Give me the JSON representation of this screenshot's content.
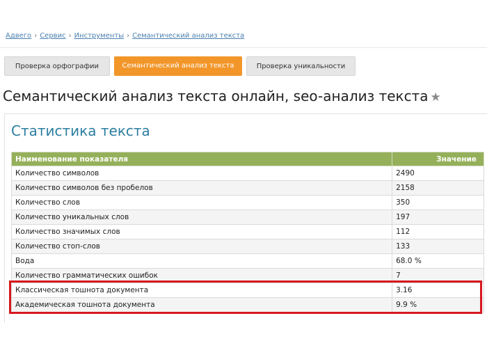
{
  "breadcrumb": {
    "items": [
      "Адвего",
      "Сервис",
      "Инструменты",
      "Семантический анализ текста"
    ],
    "separator": "›"
  },
  "tabs": [
    {
      "label": "Проверка орфографии",
      "active": false
    },
    {
      "label": "Семантический анализ текста",
      "active": true
    },
    {
      "label": "Проверка уникальности",
      "active": false
    }
  ],
  "page_title": "Семантический анализ текста онлайн, seo-анализ текста",
  "favorite_icon": "star-icon",
  "stats": {
    "title": "Статистика текста",
    "columns": [
      "Наименование показателя",
      "Значение"
    ],
    "rows": [
      {
        "name": "Количество символов",
        "value": "2490"
      },
      {
        "name": "Количество символов без пробелов",
        "value": "2158"
      },
      {
        "name": "Количество слов",
        "value": "350"
      },
      {
        "name": "Количество уникальных слов",
        "value": "197"
      },
      {
        "name": "Количество значимых слов",
        "value": "112"
      },
      {
        "name": "Количество стоп-слов",
        "value": "133"
      },
      {
        "name": "Вода",
        "value": "68.0 %"
      },
      {
        "name": "Количество грамматических ошибок",
        "value": "7"
      },
      {
        "name": "Классическая тошнота документа",
        "value": "3.16"
      },
      {
        "name": "Академическая тошнота документа",
        "value": "9.9 %"
      }
    ]
  },
  "colors": {
    "accent_tab": "#f2962a",
    "table_header": "#95b05a",
    "title_blue": "#2c7ea0",
    "highlight": "#d7191f"
  }
}
